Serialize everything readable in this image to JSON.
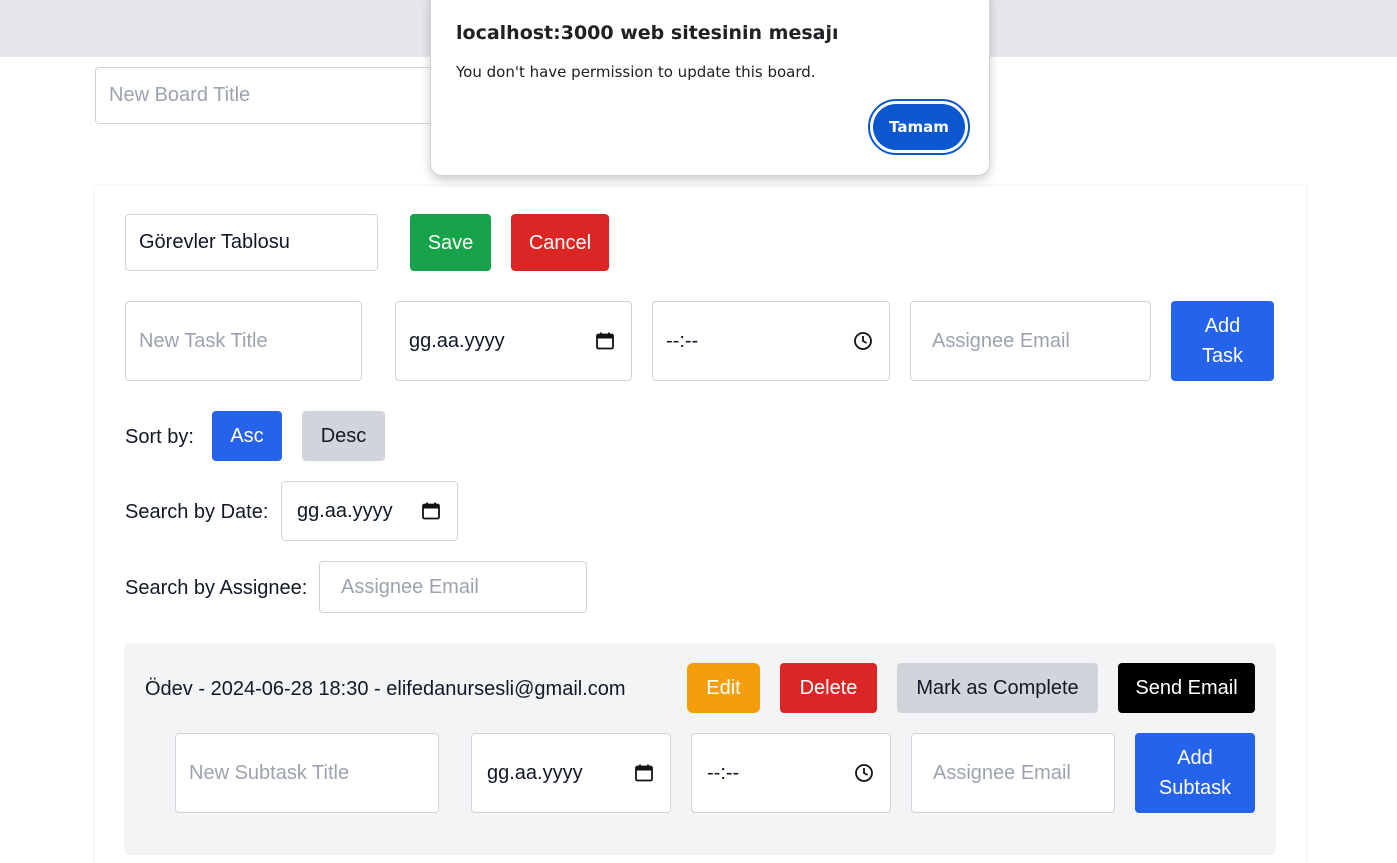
{
  "board": {
    "new_board_title_placeholder": "New Board Title"
  },
  "edit": {
    "title_value": "Görevler Tablosu",
    "save_label": "Save",
    "cancel_label": "Cancel"
  },
  "new_task": {
    "title_placeholder": "New Task Title",
    "date_placeholder": "gg.aa.yyyy",
    "time_placeholder": "--:--",
    "assignee_placeholder": "Assignee Email",
    "add_label": "Add Task"
  },
  "sort": {
    "label": "Sort by:",
    "asc_label": "Asc",
    "desc_label": "Desc"
  },
  "search_date": {
    "label": "Search by Date:",
    "placeholder": "gg.aa.yyyy"
  },
  "search_assignee": {
    "label": "Search by Assignee:",
    "placeholder": "Assignee Email"
  },
  "task": {
    "summary": "Ödev - 2024-06-28 18:30 - elifedanursesli@gmail.com",
    "edit_label": "Edit",
    "delete_label": "Delete",
    "complete_label": "Mark as Complete",
    "email_label": "Send Email",
    "subtask": {
      "title_placeholder": "New Subtask Title",
      "date_placeholder": "gg.aa.yyyy",
      "time_placeholder": "--:--",
      "assignee_placeholder": "Assignee Email",
      "add_label": "Add Subtask"
    }
  },
  "dialog": {
    "title": "localhost:3000 web sitesinin mesajı",
    "message": "You don't have permission to update this board.",
    "ok_label": "Tamam"
  },
  "colors": {
    "save": "#16a34a",
    "cancel": "#dc2626",
    "primary": "#2563eb",
    "secondary": "#d1d5db",
    "edit": "#f59e0b",
    "dialog_button": "#0b57d0"
  },
  "icons": {
    "date": "calendar-icon",
    "time": "clock-icon"
  }
}
